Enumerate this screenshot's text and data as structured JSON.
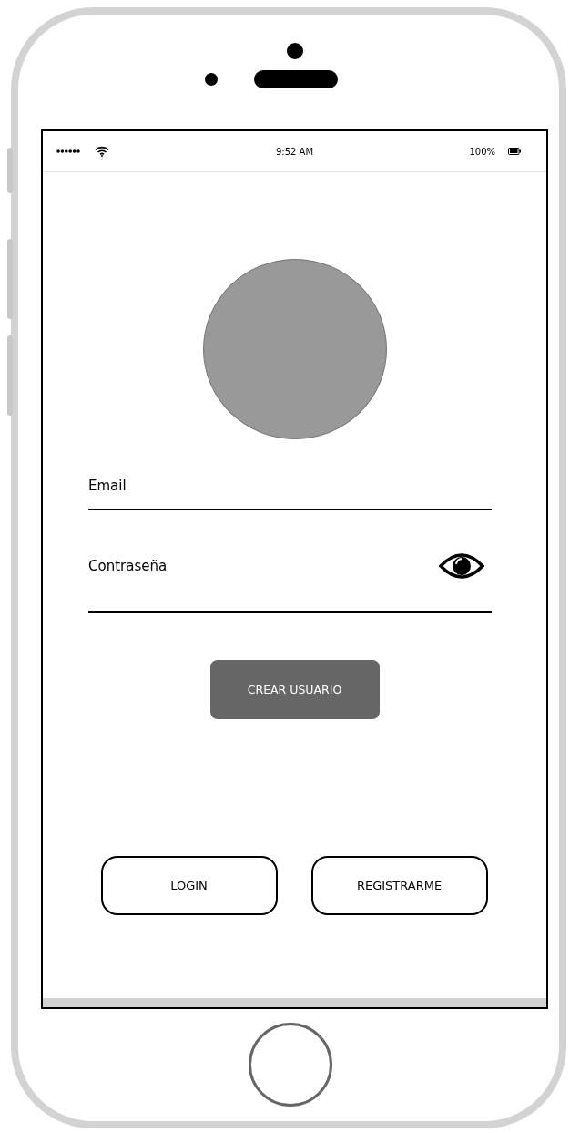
{
  "status_bar": {
    "time": "9:52 AM",
    "battery": "100%"
  },
  "fields": [
    {
      "kind": "email",
      "placeholder": "Email"
    },
    {
      "kind": "password",
      "placeholder": "Contraseña"
    }
  ],
  "primary_button": {
    "label": "CREAR USUARIO"
  },
  "buttons": [
    {
      "label": "LOGIN"
    },
    {
      "label": "REGISTRARME"
    }
  ]
}
